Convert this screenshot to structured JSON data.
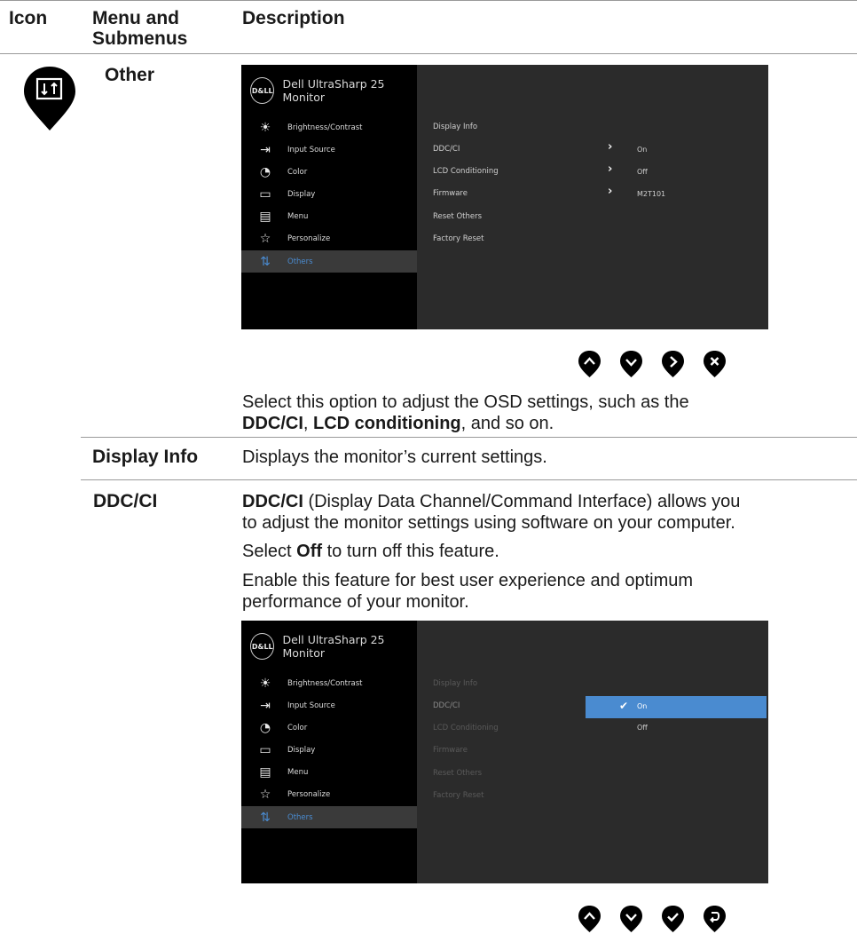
{
  "table_header": {
    "icon": "Icon",
    "menu_line1": "Menu and",
    "menu_line2": "Submenus",
    "description": "Description"
  },
  "other_row": {
    "icon": "others-pin-icon",
    "menu_label": "Other",
    "osd": {
      "brand_logo": "D&LL",
      "brand_title": "Dell UltraSharp 25 Monitor",
      "menu_items": [
        {
          "label": "Brightness/Contrast",
          "icon": "sun-icon"
        },
        {
          "label": "Input Source",
          "icon": "input-arrow-icon"
        },
        {
          "label": "Color",
          "icon": "palette-icon"
        },
        {
          "label": "Display",
          "icon": "monitor-icon"
        },
        {
          "label": "Menu",
          "icon": "menu-list-icon"
        },
        {
          "label": "Personalize",
          "icon": "star-icon"
        },
        {
          "label": "Others",
          "icon": "others-icon",
          "active": true
        }
      ],
      "submenu": [
        {
          "label": "Display Info",
          "value": ""
        },
        {
          "label": "DDC/CI",
          "value": "On"
        },
        {
          "label": "LCD Conditioning",
          "value": "Off"
        },
        {
          "label": "Firmware",
          "value": "M2T101"
        },
        {
          "label": "Reset Others",
          "value": ""
        },
        {
          "label": "Factory Reset",
          "value": ""
        }
      ]
    },
    "buttons": [
      "up-button-icon",
      "down-button-icon",
      "right-button-icon",
      "exit-button-icon"
    ],
    "desc_line1": "Select this option to adjust the OSD settings, such as the",
    "desc_b1": "DDC/CI",
    "desc_sep": ", ",
    "desc_b2": "LCD conditioning",
    "desc_tail": ", and so on."
  },
  "display_info_row": {
    "menu_label": "Display Info",
    "description": "Displays the monitor’s current settings."
  },
  "ddc_row": {
    "menu_label": "DDC/CI",
    "p1_bold": "DDC/CI",
    "p1_line1": " (Display Data Channel/Command Interface) allows you",
    "p1_line2": "to adjust the monitor settings using software on your computer.",
    "p2_pre": "Select ",
    "p2_bold": "Off",
    "p2_post": " to turn off this feature.",
    "p3_line1": "Enable this feature for best user experience and optimum",
    "p3_line2": "performance of your monitor.",
    "osd": {
      "brand_logo": "D&LL",
      "brand_title": "Dell UltraSharp 25 Monitor",
      "submenu": [
        "Display Info",
        "DDC/CI",
        "LCD Conditioning",
        "Firmware",
        "Reset Others",
        "Factory Reset"
      ],
      "options": [
        {
          "label": "On",
          "selected": true,
          "check": "✔"
        },
        {
          "label": "Off",
          "selected": false
        }
      ]
    },
    "buttons": [
      "up-button-icon",
      "down-button-icon",
      "confirm-button-icon",
      "back-button-icon"
    ]
  }
}
